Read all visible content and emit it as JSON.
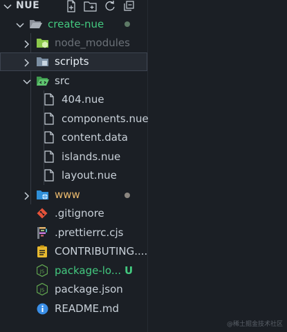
{
  "section": {
    "title": "NUE"
  },
  "toolbar": {
    "actions": [
      "new-file-icon",
      "new-folder-icon",
      "refresh-icon",
      "collapse-all-icon"
    ]
  },
  "tree": [
    {
      "label": "create-nue",
      "kind": "folder-open",
      "depth": 0,
      "color": "#43c97f"
    },
    {
      "label": "node_modules",
      "kind": "folder-closed",
      "depth": 1,
      "color": "#6b7178"
    },
    {
      "label": "scripts",
      "kind": "folder-closed",
      "depth": 1,
      "color": "#e6edf3"
    },
    {
      "label": "src",
      "kind": "folder-open",
      "depth": 1,
      "color": "#c9d1d9"
    },
    {
      "label": "404.nue",
      "kind": "file",
      "depth": 2,
      "color": "#c9d1d9"
    },
    {
      "label": "components.nue",
      "kind": "file",
      "depth": 2,
      "color": "#c9d1d9"
    },
    {
      "label": "content.data",
      "kind": "file",
      "depth": 2,
      "color": "#c9d1d9"
    },
    {
      "label": "islands.nue",
      "kind": "file",
      "depth": 2,
      "color": "#c9d1d9"
    },
    {
      "label": "layout.nue",
      "kind": "file",
      "depth": 2,
      "color": "#c9d1d9"
    },
    {
      "label": "www",
      "kind": "folder-closed",
      "depth": 1,
      "color": "#e8b86d"
    },
    {
      "label": ".gitignore",
      "kind": "file",
      "depth": 1,
      "color": "#c9d1d9"
    },
    {
      "label": ".prettierrc.cjs",
      "kind": "file",
      "depth": 1,
      "color": "#c9d1d9"
    },
    {
      "label": "CONTRIBUTING....",
      "kind": "file",
      "depth": 1,
      "color": "#c9d1d9"
    },
    {
      "label": "package-lo...",
      "kind": "file",
      "depth": 1,
      "color": "#43c97f"
    },
    {
      "label": "package.json",
      "kind": "file",
      "depth": 1,
      "color": "#c9d1d9"
    },
    {
      "label": "README.md",
      "kind": "file",
      "depth": 1,
      "color": "#c9d1d9"
    }
  ],
  "badges": {
    "package_lock": "U"
  },
  "watermark": "@稀土掘金技术社区",
  "colors": {
    "accent_green": "#43c97f",
    "modified_dot": "#8b8680",
    "warning_yellow": "#e8b86d",
    "selection_bg": "#262b33"
  }
}
